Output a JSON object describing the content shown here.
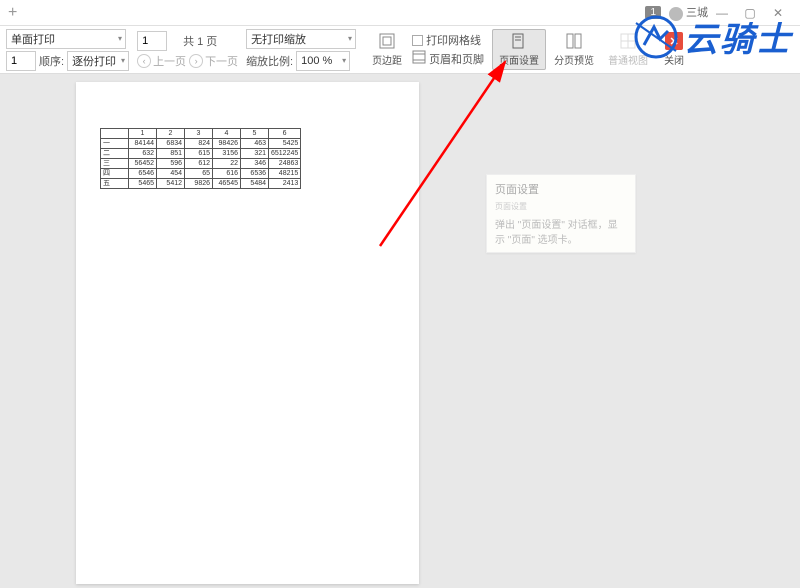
{
  "titlebar": {
    "badge": "1",
    "username": "三城"
  },
  "toolbar": {
    "print_side": "单面打印",
    "copies": "1",
    "order_label": "顺序:",
    "order_value": "逐份打印",
    "page_num": "1",
    "page_total": "共 1 页",
    "prev_page": "上一页",
    "next_page": "下一页",
    "scale_mode": "无打印缩放",
    "scale_label": "缩放比例:",
    "scale_value": "100 %",
    "margin": "页边距",
    "gridlines": "打印网格线",
    "header_footer": "页眉和页脚",
    "page_setup": "页面设置",
    "page_break": "分页预览",
    "normal_view": "普通视图",
    "close": "关闭"
  },
  "tooltip": {
    "title": "页面设置",
    "subtitle": "页面设置",
    "body": "弹出 \"页面设置\" 对话框，显示 \"页面\" 选项卡。"
  },
  "table": {
    "cols": [
      "1",
      "2",
      "3",
      "4",
      "5",
      "6"
    ],
    "rows": [
      {
        "h": "一",
        "c": [
          "84144",
          "6834",
          "824",
          "98426",
          "463",
          "5425"
        ]
      },
      {
        "h": "二",
        "c": [
          "632",
          "851",
          "615",
          "3156",
          "321",
          "6512245"
        ]
      },
      {
        "h": "三",
        "c": [
          "56452",
          "596",
          "612",
          "22",
          "346",
          "24863"
        ]
      },
      {
        "h": "四",
        "c": [
          "6546",
          "454",
          "65",
          "616",
          "6536",
          "48215"
        ]
      },
      {
        "h": "五",
        "c": [
          "5465",
          "5412",
          "9826",
          "46545",
          "5484",
          "2413"
        ]
      }
    ]
  },
  "watermark": {
    "text": "云骑士"
  }
}
